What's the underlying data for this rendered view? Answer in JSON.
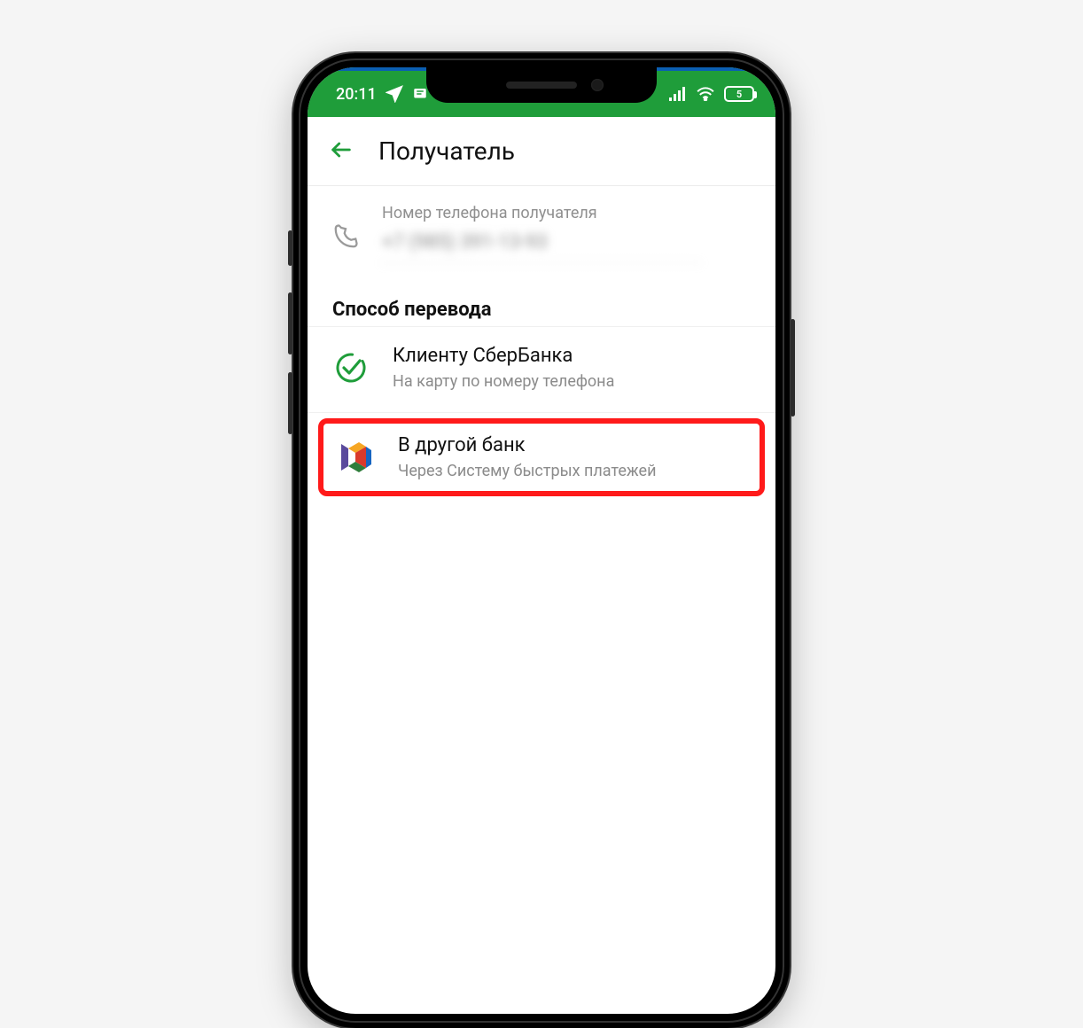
{
  "status": {
    "time": "20:11",
    "battery_text": "5"
  },
  "header": {
    "title": "Получатель"
  },
  "phone_field": {
    "label": "Номер телефона получателя",
    "value": "+7 (985) 391-13-93"
  },
  "method": {
    "section_title": "Способ перевода",
    "options": [
      {
        "title": "Клиенту СберБанка",
        "subtitle": "На карту по номеру телефона"
      },
      {
        "title": "В другой банк",
        "subtitle": "Через Систему быстрых платежей"
      }
    ]
  },
  "colors": {
    "accent_green": "#1f9d3a",
    "highlight_red": "#ff1a1a"
  }
}
